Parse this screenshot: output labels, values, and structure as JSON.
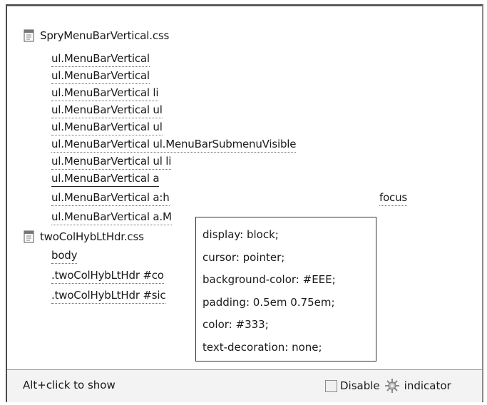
{
  "files": [
    {
      "name": "SpryMenuBarVertical.css",
      "rules": [
        "ul.MenuBarVertical",
        "ul.MenuBarVertical",
        "ul.MenuBarVertical li",
        "ul.MenuBarVertical ul",
        "ul.MenuBarVertical ul",
        "ul.MenuBarVertical ul.MenuBarSubmenuVisible",
        "ul.MenuBarVertical ul li",
        "ul.MenuBarVertical a",
        "ul.MenuBarVertical a:h",
        "ul.MenuBarVertical a.M"
      ],
      "rule9_tail": "focus"
    },
    {
      "name": "twoColHybLtHdr.css",
      "rules": [
        "body",
        ".twoColHybLtHdr #co",
        ".twoColHybLtHdr #sic"
      ]
    }
  ],
  "tooltip": {
    "properties": [
      "display: block;",
      "cursor: pointer;",
      "background-color: #EEE;",
      "padding: 0.5em 0.75em;",
      "color: #333;",
      "text-decoration: none;"
    ]
  },
  "status": {
    "hint": "Alt+click to show",
    "disable_label": "Disable",
    "indicator_label": "indicator",
    "disabled_checked": false
  }
}
